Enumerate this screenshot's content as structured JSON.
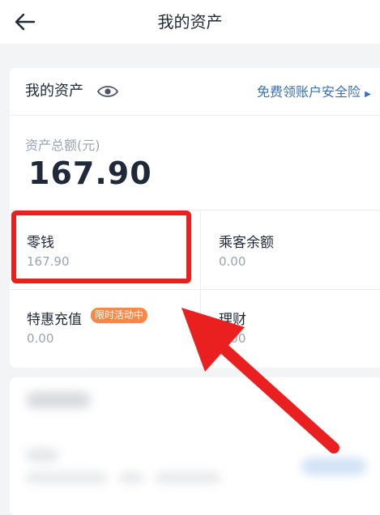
{
  "header": {
    "title": "我的资产"
  },
  "assets": {
    "title": "我的资产",
    "insurance_link": "免费领账户安全险",
    "total_label": "资产总额(元)",
    "total_value": "167.90",
    "items": [
      {
        "label": "零钱",
        "value": "167.90"
      },
      {
        "label": "乘客余额",
        "value": "0.00"
      },
      {
        "label": "特惠充值",
        "value": "0.00",
        "badge": "限时活动中"
      },
      {
        "label": "理财",
        "value": "0.00"
      }
    ]
  },
  "colors": {
    "link": "#3a6fb0",
    "badge": "#f5894c",
    "highlight": "#ea2020"
  }
}
